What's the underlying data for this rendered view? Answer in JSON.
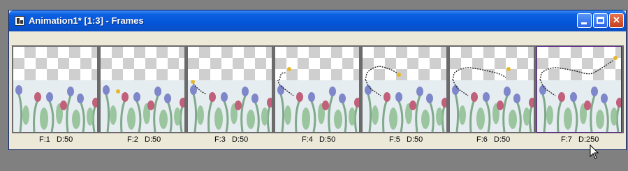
{
  "window": {
    "title": "Animation1* [1:3] - Frames",
    "buttons": {
      "minimize": "minimize",
      "maximize": "maximize",
      "close": "close"
    }
  },
  "frames": [
    {
      "label": "F:1   D:50"
    },
    {
      "label": "F:2   D:50"
    },
    {
      "label": "F:3   D:50"
    },
    {
      "label": "F:4   D:50"
    },
    {
      "label": "F:5   D:50"
    },
    {
      "label": "F:6   D:50"
    },
    {
      "label": "F:7   D:250",
      "selected": true
    }
  ],
  "colors": {
    "titlebar": "#0556d8",
    "selection": "#5a1e8c",
    "window_bg": "#ece9d8",
    "desktop": "#808080"
  }
}
